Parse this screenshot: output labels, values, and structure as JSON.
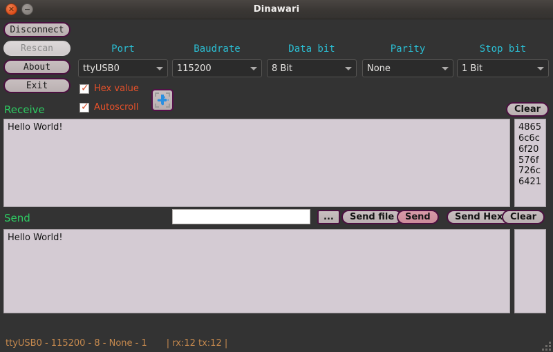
{
  "window": {
    "title": "Dinawari",
    "close_icon": "close-icon",
    "minimize_icon": "minimize-icon"
  },
  "toolbar": {
    "buttons": [
      {
        "label": "Disconnect",
        "disabled": false
      },
      {
        "label": "Rescan",
        "disabled": true
      },
      {
        "label": "About",
        "disabled": false
      },
      {
        "label": "Exit",
        "disabled": false
      }
    ],
    "checkboxes": [
      {
        "label": "Hex value",
        "checked": true
      },
      {
        "label": "Autoscroll",
        "checked": true
      }
    ],
    "plugin_button": {
      "icon": "puzzle-piece-icon"
    }
  },
  "settings": [
    {
      "label": "Port",
      "value": "ttyUSB0"
    },
    {
      "label": "Baudrate",
      "value": "115200"
    },
    {
      "label": "Data bit",
      "value": "8 Bit"
    },
    {
      "label": "Parity",
      "value": "None"
    },
    {
      "label": "Stop bit",
      "value": "1 Bit"
    }
  ],
  "receive": {
    "title": "Receive",
    "clear_label": "Clear",
    "text": "Hello World!",
    "hex": "48656c6c6f20576f726c6421"
  },
  "send": {
    "title": "Send",
    "input_value": "",
    "input_placeholder": "",
    "browse_label": "...",
    "send_file_label": "Send file",
    "send_label": "Send",
    "send_hex_label": "Send Hex",
    "clear_label": "Clear",
    "text": "Hello World!",
    "hex": ""
  },
  "status": {
    "connection": "ttyUSB0 - 115200 - 8 - None - 1",
    "counters": "| rx:12    tx:12 |"
  },
  "colors": {
    "accent_label": "#2bbfd4",
    "section_title": "#2ecc63",
    "checkbox_text": "#e8512a",
    "status_text": "#c78a4e",
    "button_border": "#4b1040",
    "send_button_bg": "#cc8b9a",
    "pane_bg": "#d4cbd3",
    "window_bg": "#333333"
  }
}
